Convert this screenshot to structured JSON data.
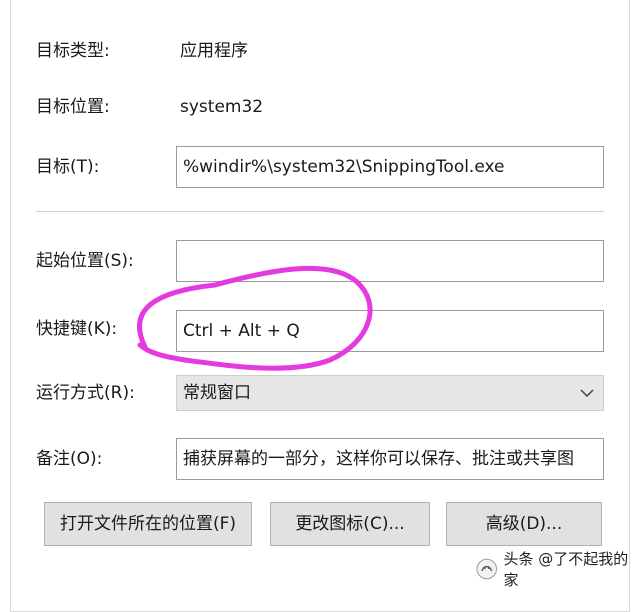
{
  "properties": {
    "target_type_label": "目标类型:",
    "target_type_value": "应用程序",
    "target_location_label": "目标位置:",
    "target_location_value": "system32",
    "target_label": "目标(T):",
    "target_value": "%windir%\\system32\\SnippingTool.exe",
    "start_in_label": "起始位置(S):",
    "start_in_value": "",
    "shortcut_key_label": "快捷键(K):",
    "shortcut_key_value": "Ctrl + Alt + Q",
    "run_label": "运行方式(R):",
    "run_value": "常规窗口",
    "comment_label": "备注(O):",
    "comment_value": "捕获屏幕的一部分，这样你可以保存、批注或共享图"
  },
  "buttons": {
    "open_location": "打开文件所在的位置(F)",
    "change_icon": "更改图标(C)...",
    "advanced": "高级(D)..."
  },
  "watermark": {
    "text": "头条 @了不起我的家"
  },
  "colors": {
    "annotation": "#e43ae0",
    "combo_bg": "#e6e6e6",
    "button_bg": "#e1e1e1"
  },
  "icons": {
    "dropdown": "chevron-down-icon",
    "watermark_logo": "toutiao-logo-icon"
  }
}
